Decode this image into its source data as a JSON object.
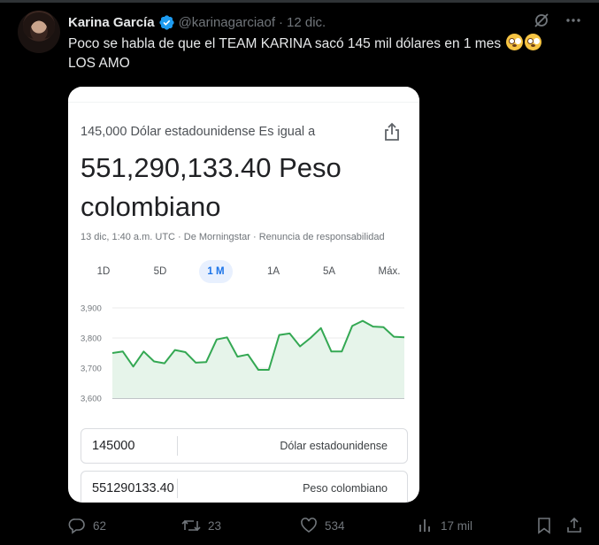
{
  "tweet": {
    "author_name": "Karina García",
    "handle": "@karinagarciaof",
    "separator": "·",
    "date": "12 dic.",
    "text_line1": "Poco se habla de que el TEAM KARINA sacó 145 mil dólares en 1 mes",
    "text_line2": "LOS AMO"
  },
  "card": {
    "subtitle": "145,000 Dólar estadounidense Es igual a",
    "result_line1": "551,290,133.40 Peso",
    "result_line2": "colombiano",
    "meta": "13 dic, 1:40 a.m. UTC · De Morningstar · Renuncia de responsabilidad",
    "ranges": [
      "1D",
      "5D",
      "1 M",
      "1A",
      "5A",
      "Máx."
    ],
    "active_range": "1 M",
    "from_value": "145000",
    "from_unit": "Dólar estadounidense",
    "to_value": "551290133.40",
    "to_unit": "Peso colombiano"
  },
  "chart_data": {
    "type": "line",
    "y_ticks": [
      "3,900",
      "3,800",
      "3,700",
      "3,600"
    ],
    "ylim": [
      3600,
      3900
    ],
    "values": [
      3750,
      3755,
      3705,
      3755,
      3722,
      3716,
      3760,
      3753,
      3718,
      3720,
      3795,
      3802,
      3738,
      3745,
      3694,
      3694,
      3810,
      3815,
      3772,
      3800,
      3833,
      3755,
      3755,
      3840,
      3857,
      3838,
      3836,
      3804,
      3802
    ],
    "line_color": "#34a853",
    "fill_color": "#e6f4ea",
    "grid": true
  },
  "actions": {
    "replies": "62",
    "reposts": "23",
    "likes": "534",
    "views": "17 mil"
  },
  "icons": {
    "verified": "verified-badge-icon",
    "grok": "grok-icon",
    "more": "more-icon",
    "share_card": "share-icon",
    "reply": "reply-icon",
    "repost": "repost-icon",
    "like": "like-icon",
    "views": "views-icon",
    "bookmark": "bookmark-icon",
    "share": "share-icon"
  },
  "colors": {
    "accent_blue": "#1d9bf0",
    "text_secondary": "#71767b"
  }
}
